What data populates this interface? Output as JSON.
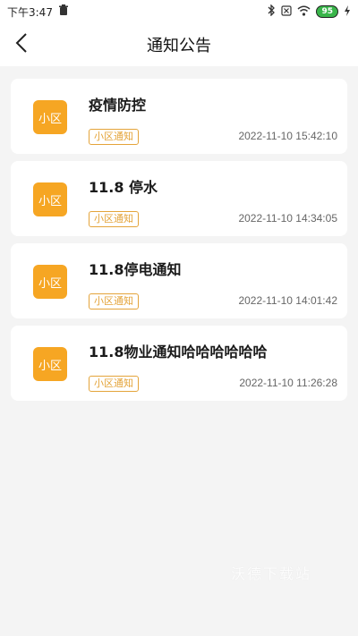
{
  "status_bar": {
    "time": "下午3:47",
    "battery": "95"
  },
  "nav": {
    "title": "通知公告",
    "back_icon": "chevron-left-icon"
  },
  "notices": [
    {
      "icon_label": "小区",
      "title": "疫情防控",
      "tag": "小区通知",
      "time": "2022-11-10 15:42:10"
    },
    {
      "icon_label": "小区",
      "title": "11.8 停水",
      "tag": "小区通知",
      "time": "2022-11-10 14:34:05"
    },
    {
      "icon_label": "小区",
      "title": "11.8停电通知",
      "tag": "小区通知",
      "time": "2022-11-10 14:01:42"
    },
    {
      "icon_label": "小区",
      "title": "11.8物业通知哈哈哈哈哈哈",
      "tag": "小区通知",
      "time": "2022-11-10 11:26:28"
    }
  ],
  "watermark": "沃德下载站",
  "colors": {
    "accent": "#f6a623",
    "tag_border": "#e4a43a",
    "background": "#f4f4f4"
  }
}
